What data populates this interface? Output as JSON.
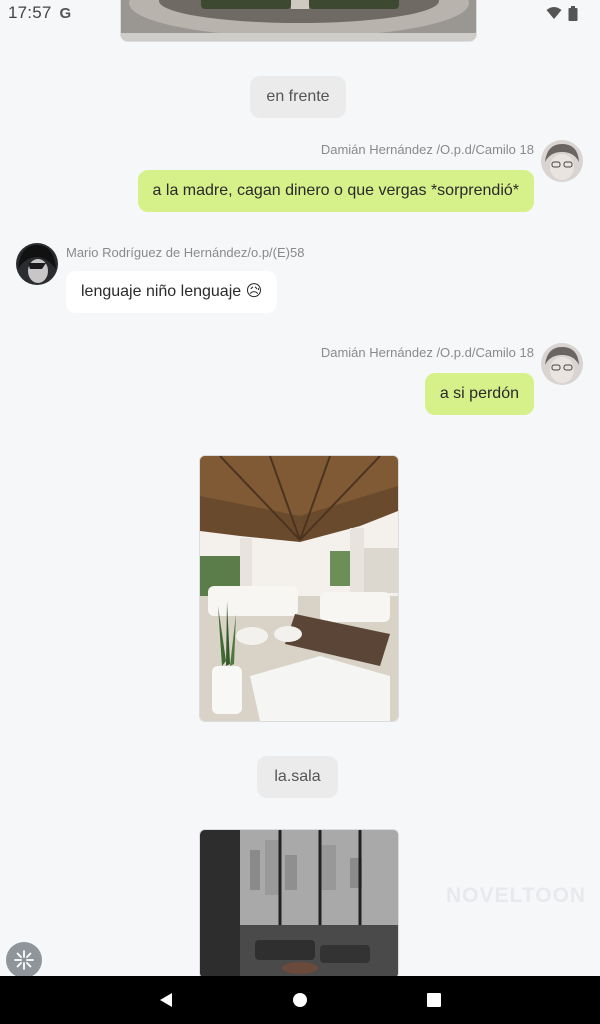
{
  "status_bar": {
    "time": "17:57",
    "google_glyph": "G"
  },
  "messages": {
    "narration_1": "en frente",
    "sender_1": "Damián Hernández /O.p.d/Camilo 18",
    "bubble_1": "a la madre, cagan dinero o que vergas *sorprendió*",
    "sender_2": "Mario Rodríguez de Hernández/o.p/(E)58",
    "bubble_2": "lenguaje niño lenguaje 😥",
    "sender_3": "Damián Hernández /O.p.d/Camilo 18",
    "bubble_3": "a si perdón",
    "narration_2": "la.sala"
  },
  "watermark": "NOVELTOON",
  "colors": {
    "outgoing_bubble": "#d6f08a",
    "incoming_bubble": "#ffffff",
    "narration_bubble": "#ebebeb",
    "background": "#f5f7f9"
  },
  "icons": [
    "wifi-icon",
    "battery-icon",
    "back-icon",
    "home-icon",
    "recents-icon",
    "sparkle-icon"
  ]
}
